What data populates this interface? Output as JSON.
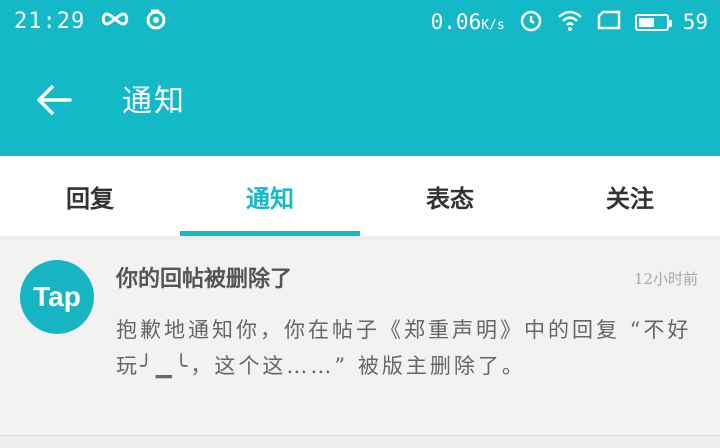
{
  "status_bar": {
    "time": "21:29",
    "net_speed": "0.06",
    "net_unit": "K/s",
    "battery_percent": "59",
    "battery_level": 0.59
  },
  "app_bar": {
    "title": "通知"
  },
  "tabs": [
    {
      "label": "回复",
      "active": false
    },
    {
      "label": "通知",
      "active": true
    },
    {
      "label": "表态",
      "active": false
    },
    {
      "label": "关注",
      "active": false
    }
  ],
  "notification": {
    "avatar_text": "Tap",
    "title": "你的回帖被删除了",
    "time": "12小时前",
    "body": "抱歉地通知你，你在帖子《郑重声明》中的回复 “不好玩╯▁╰，这个这……” 被版主删除了。"
  },
  "colors": {
    "accent": "#14b9c8",
    "background": "#eeeeee"
  }
}
